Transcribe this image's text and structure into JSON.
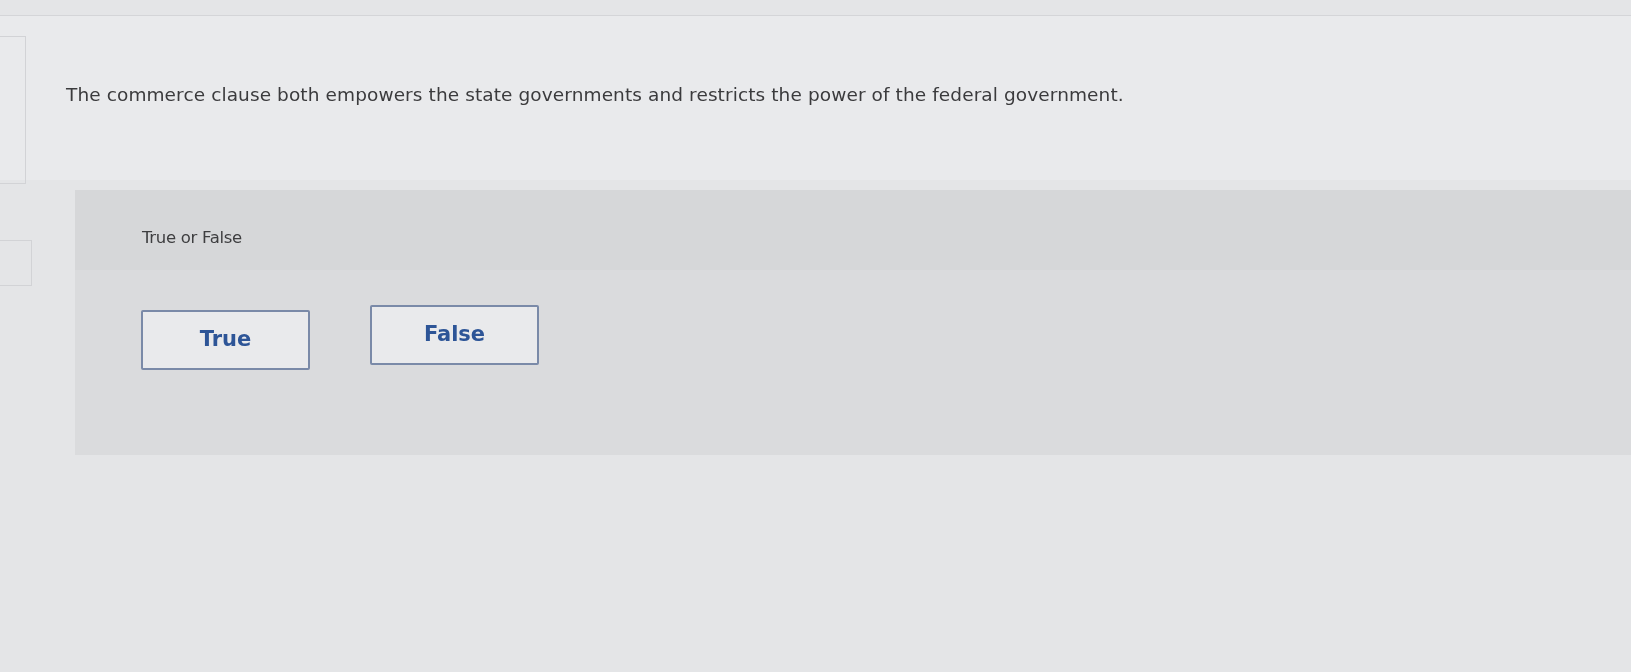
{
  "question": {
    "text": "The commerce clause both empowers the state governments and restricts the power of the federal government."
  },
  "answer_panel": {
    "prompt": "True or False",
    "options": [
      {
        "label": "True",
        "selected": false
      },
      {
        "label": "False",
        "selected": false
      }
    ]
  }
}
